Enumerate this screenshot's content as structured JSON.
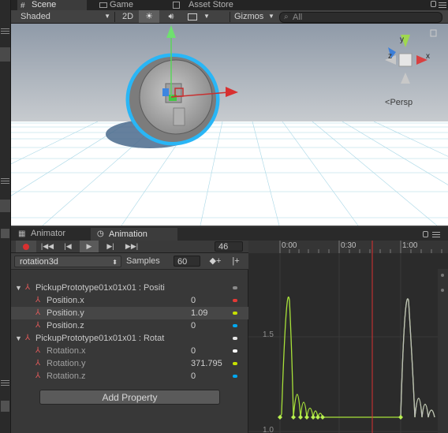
{
  "scene_tabs": [
    {
      "label": "Scene",
      "active": true
    },
    {
      "label": "Game",
      "active": false
    },
    {
      "label": "Asset Store",
      "active": false
    }
  ],
  "scene_toolbar": {
    "shading_mode": "Shaded",
    "mode_2d": "2D",
    "gizmos": "Gizmos",
    "search_placeholder": "All"
  },
  "scene_view": {
    "projection_label": "Persp",
    "axis_labels": {
      "z": "z",
      "x": "x",
      "y": "y"
    }
  },
  "anim_tabs": [
    {
      "label": "Animator",
      "active": false
    },
    {
      "label": "Animation",
      "active": true
    }
  ],
  "anim_toolbar": {
    "frame": "46",
    "timeline_labels": [
      "0:00",
      "0:30",
      "1:00"
    ]
  },
  "clip": {
    "name": "rotation3d",
    "samples_label": "Samples",
    "samples_value": "60"
  },
  "properties": [
    {
      "name": "PickupPrototype01x01x01 : Positi",
      "children": [
        {
          "name": "Position.x",
          "value": "0",
          "color": "#e53935"
        },
        {
          "name": "Position.y",
          "value": "1.09",
          "color": "#c6e000",
          "selected": true
        },
        {
          "name": "Position.z",
          "value": "0",
          "color": "#00a8f0"
        }
      ]
    },
    {
      "name": "PickupPrototype01x01x01 : Rotat",
      "children": [
        {
          "name": "Rotation.x",
          "value": "0",
          "color": "#ffffff"
        },
        {
          "name": "Rotation.y",
          "value": "371.795",
          "color": "#c6e000"
        },
        {
          "name": "Rotation.z",
          "value": "0",
          "color": "#00a8f0"
        }
      ]
    }
  ],
  "add_property": "Add Property",
  "curve_editor": {
    "y_labels": [
      "1.5",
      "1.0"
    ]
  },
  "colors": {
    "accent_selection": "#29b6f6",
    "curve_green": "#a8e23a",
    "playhead": "#e03030",
    "record_red": "#d83030"
  }
}
